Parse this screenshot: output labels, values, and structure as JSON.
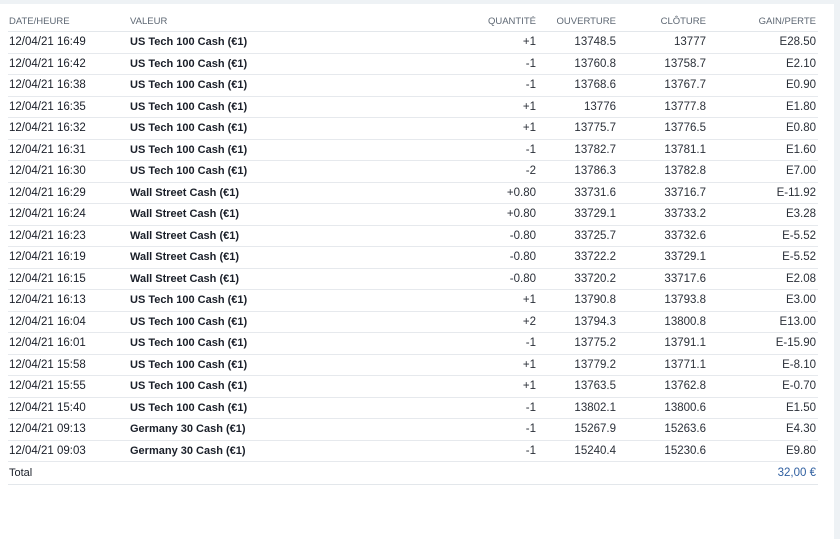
{
  "headers": {
    "date": "DATE/HEURE",
    "value": "VALEUR",
    "qty": "QUANTITÉ",
    "open": "OUVERTURE",
    "close": "CLÔTURE",
    "gain": "GAIN/PERTE"
  },
  "rows": [
    {
      "date": "12/04/21 16:49",
      "value": "US Tech 100 Cash (€1)",
      "qty": "+1",
      "open": "13748.5",
      "close": "13777",
      "gain": "E28.50",
      "qty_sign": "pos",
      "gain_sign": "pos"
    },
    {
      "date": "12/04/21 16:42",
      "value": "US Tech 100 Cash (€1)",
      "qty": "-1",
      "open": "13760.8",
      "close": "13758.7",
      "gain": "E2.10",
      "qty_sign": "neg",
      "gain_sign": "pos"
    },
    {
      "date": "12/04/21 16:38",
      "value": "US Tech 100 Cash (€1)",
      "qty": "-1",
      "open": "13768.6",
      "close": "13767.7",
      "gain": "E0.90",
      "qty_sign": "neg",
      "gain_sign": "pos"
    },
    {
      "date": "12/04/21 16:35",
      "value": "US Tech 100 Cash (€1)",
      "qty": "+1",
      "open": "13776",
      "close": "13777.8",
      "gain": "E1.80",
      "qty_sign": "pos",
      "gain_sign": "pos"
    },
    {
      "date": "12/04/21 16:32",
      "value": "US Tech 100 Cash (€1)",
      "qty": "+1",
      "open": "13775.7",
      "close": "13776.5",
      "gain": "E0.80",
      "qty_sign": "pos",
      "gain_sign": "pos"
    },
    {
      "date": "12/04/21 16:31",
      "value": "US Tech 100 Cash (€1)",
      "qty": "-1",
      "open": "13782.7",
      "close": "13781.1",
      "gain": "E1.60",
      "qty_sign": "neg",
      "gain_sign": "pos"
    },
    {
      "date": "12/04/21 16:30",
      "value": "US Tech 100 Cash (€1)",
      "qty": "-2",
      "open": "13786.3",
      "close": "13782.8",
      "gain": "E7.00",
      "qty_sign": "neg",
      "gain_sign": "pos"
    },
    {
      "date": "12/04/21 16:29",
      "value": "Wall Street Cash (€1)",
      "qty": "+0.80",
      "open": "33731.6",
      "close": "33716.7",
      "gain": "E-11.92",
      "qty_sign": "pos",
      "gain_sign": "neg"
    },
    {
      "date": "12/04/21 16:24",
      "value": "Wall Street Cash (€1)",
      "qty": "+0.80",
      "open": "33729.1",
      "close": "33733.2",
      "gain": "E3.28",
      "qty_sign": "pos",
      "gain_sign": "pos"
    },
    {
      "date": "12/04/21 16:23",
      "value": "Wall Street Cash (€1)",
      "qty": "-0.80",
      "open": "33725.7",
      "close": "33732.6",
      "gain": "E-5.52",
      "qty_sign": "neg",
      "gain_sign": "neg"
    },
    {
      "date": "12/04/21 16:19",
      "value": "Wall Street Cash (€1)",
      "qty": "-0.80",
      "open": "33722.2",
      "close": "33729.1",
      "gain": "E-5.52",
      "qty_sign": "neg",
      "gain_sign": "neg"
    },
    {
      "date": "12/04/21 16:15",
      "value": "Wall Street Cash (€1)",
      "qty": "-0.80",
      "open": "33720.2",
      "close": "33717.6",
      "gain": "E2.08",
      "qty_sign": "neg",
      "gain_sign": "pos"
    },
    {
      "date": "12/04/21 16:13",
      "value": "US Tech 100 Cash (€1)",
      "qty": "+1",
      "open": "13790.8",
      "close": "13793.8",
      "gain": "E3.00",
      "qty_sign": "pos",
      "gain_sign": "pos"
    },
    {
      "date": "12/04/21 16:04",
      "value": "US Tech 100 Cash (€1)",
      "qty": "+2",
      "open": "13794.3",
      "close": "13800.8",
      "gain": "E13.00",
      "qty_sign": "pos",
      "gain_sign": "pos"
    },
    {
      "date": "12/04/21 16:01",
      "value": "US Tech 100 Cash (€1)",
      "qty": "-1",
      "open": "13775.2",
      "close": "13791.1",
      "gain": "E-15.90",
      "qty_sign": "neg",
      "gain_sign": "neg"
    },
    {
      "date": "12/04/21 15:58",
      "value": "US Tech 100 Cash (€1)",
      "qty": "+1",
      "open": "13779.2",
      "close": "13771.1",
      "gain": "E-8.10",
      "qty_sign": "pos",
      "gain_sign": "neg"
    },
    {
      "date": "12/04/21 15:55",
      "value": "US Tech 100 Cash (€1)",
      "qty": "+1",
      "open": "13763.5",
      "close": "13762.8",
      "gain": "E-0.70",
      "qty_sign": "pos",
      "gain_sign": "neg"
    },
    {
      "date": "12/04/21 15:40",
      "value": "US Tech 100 Cash (€1)",
      "qty": "-1",
      "open": "13802.1",
      "close": "13800.6",
      "gain": "E1.50",
      "qty_sign": "neg",
      "gain_sign": "pos"
    },
    {
      "date": "12/04/21 09:13",
      "value": "Germany 30 Cash (€1)",
      "qty": "-1",
      "open": "15267.9",
      "close": "15263.6",
      "gain": "E4.30",
      "qty_sign": "neg",
      "gain_sign": "pos"
    },
    {
      "date": "12/04/21 09:03",
      "value": "Germany 30 Cash (€1)",
      "qty": "-1",
      "open": "15240.4",
      "close": "15230.6",
      "gain": "E9.80",
      "qty_sign": "neg",
      "gain_sign": "pos"
    }
  ],
  "total": {
    "label": "Total",
    "amount": "32,00 €"
  },
  "colors": {
    "positive": "#2f5fa0",
    "negative": "#b23a3a"
  }
}
